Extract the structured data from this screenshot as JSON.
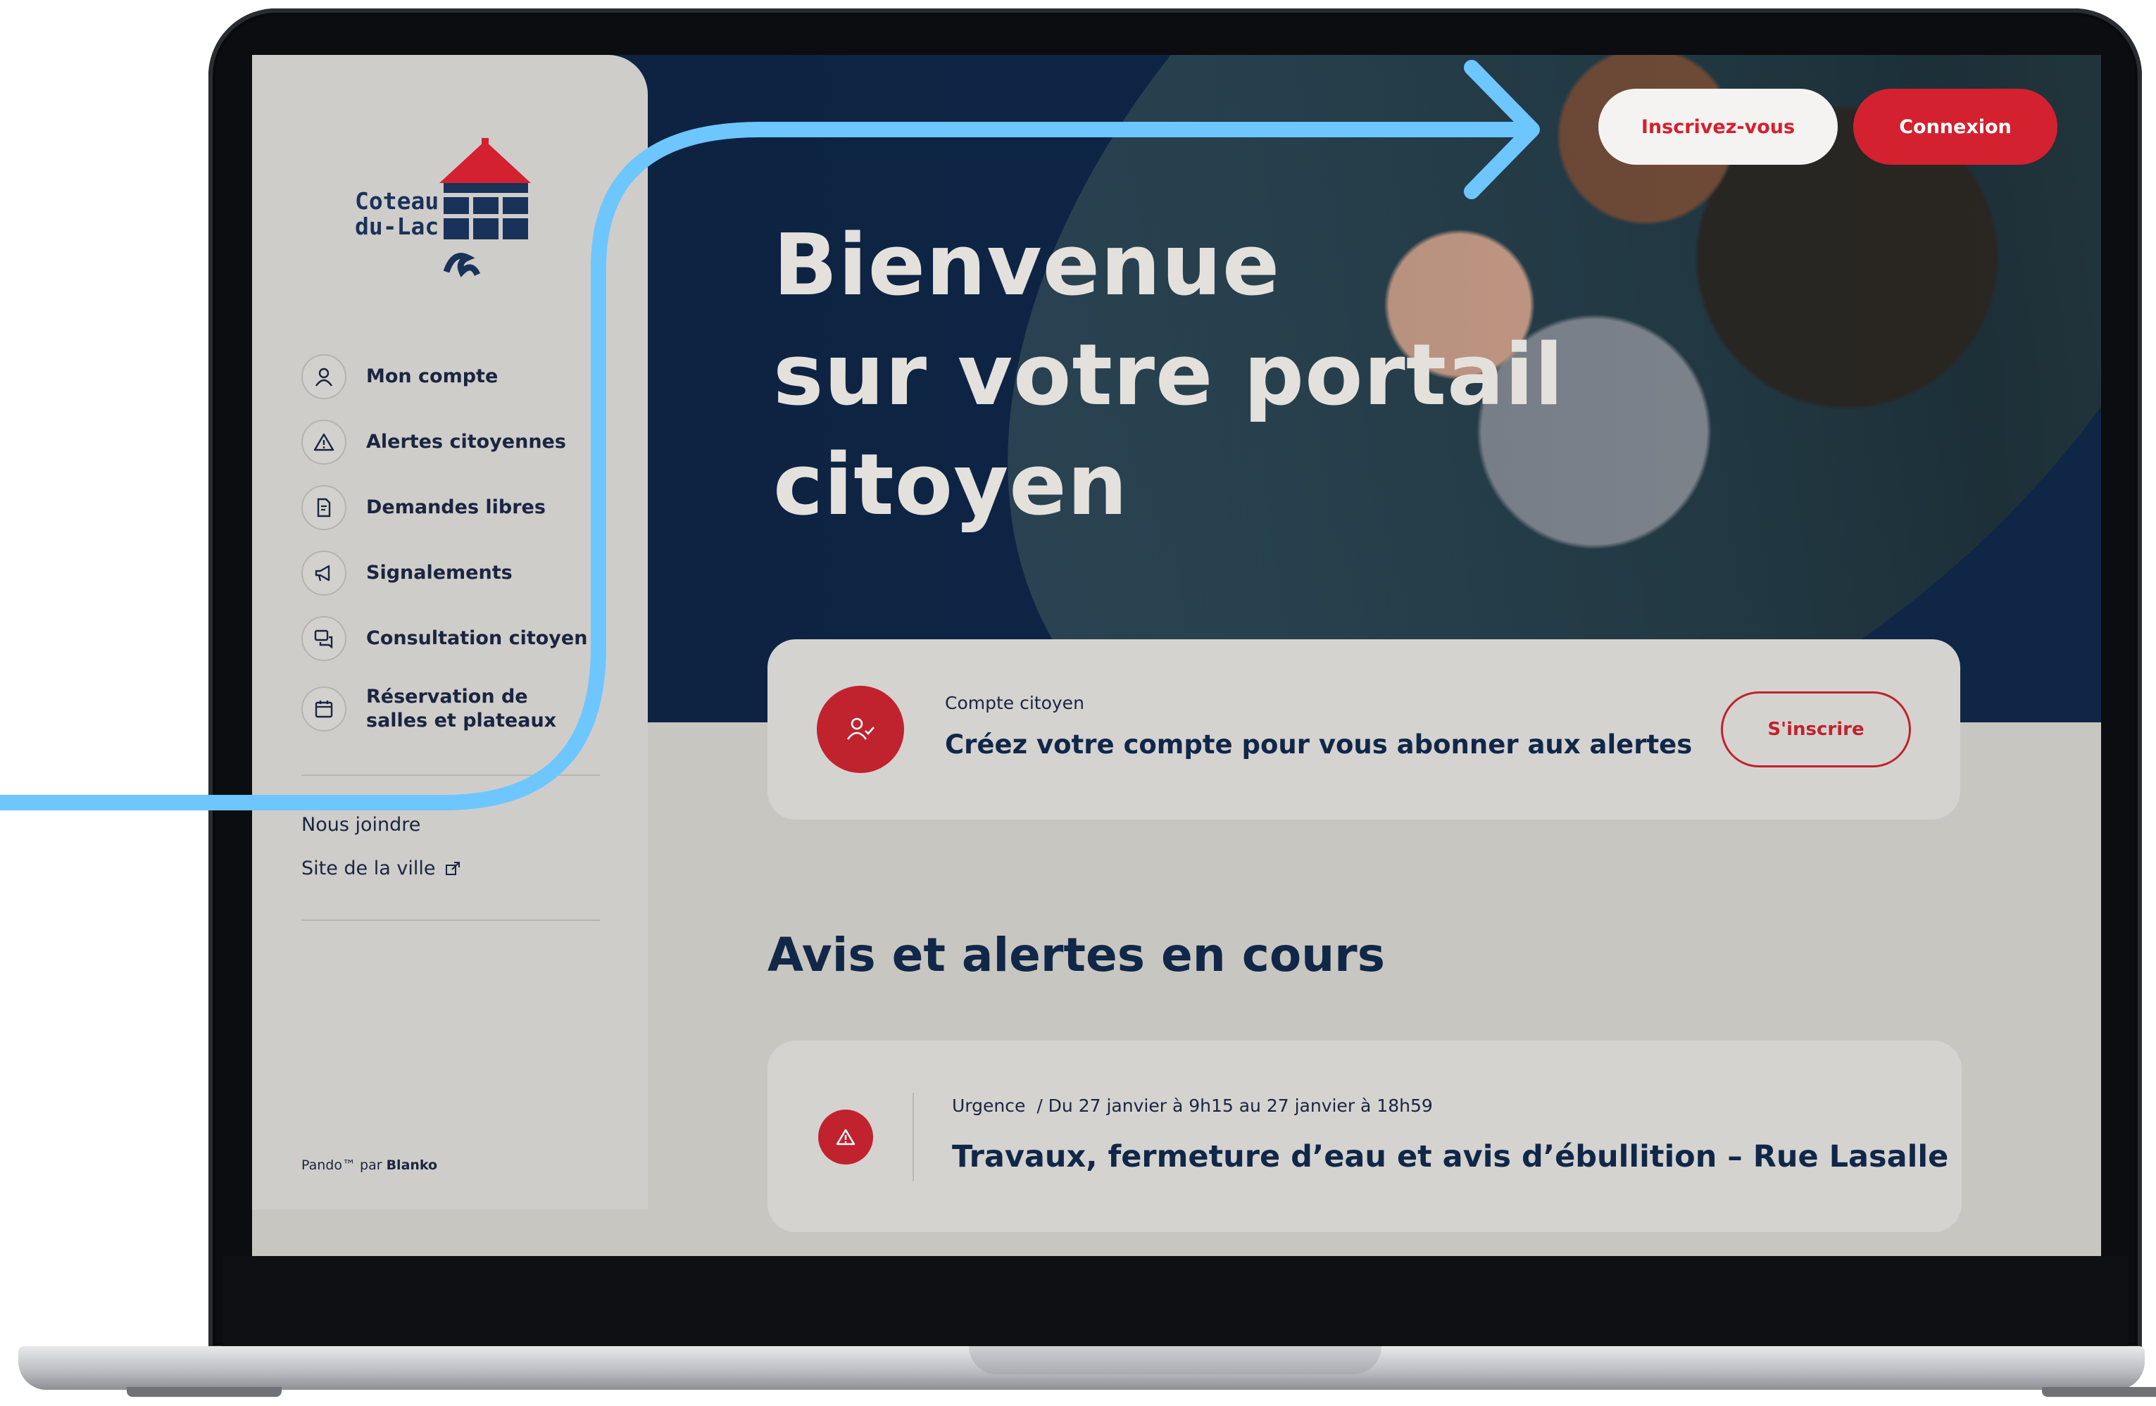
{
  "header": {
    "signup_label": "Inscrivez-vous",
    "login_label": "Connexion"
  },
  "hero": {
    "title_lines": [
      "Bienvenue",
      "sur votre portail",
      "citoyen"
    ]
  },
  "logo": {
    "lines": [
      "Coteau",
      "du-Lac"
    ]
  },
  "sidebar": {
    "items": [
      {
        "label": "Mon compte",
        "icon": "user-icon"
      },
      {
        "label": "Alertes citoyennes",
        "icon": "warning-icon"
      },
      {
        "label": "Demandes libres",
        "icon": "document-icon"
      },
      {
        "label": "Signalements",
        "icon": "megaphone-icon"
      },
      {
        "label": "Consultation citoyenne",
        "icon": "chat-icon"
      },
      {
        "label": "Réservation de salles et plateaux",
        "icon": "calendar-icon"
      }
    ],
    "contact_label": "Nous joindre",
    "city_site_label": "Site de la ville",
    "powered_prefix": "Pando™ par",
    "powered_brand": "Blanko"
  },
  "account_card": {
    "kicker": "Compte citoyen",
    "title": "Créez votre compte pour vous abonner aux alertes",
    "button_label": "S'inscrire"
  },
  "alerts": {
    "section_title": "Avis et alertes en cours",
    "items": [
      {
        "category": "Urgence",
        "period": "/ Du 27 janvier à 9h15 au 27 janvier à 18h59",
        "title": "Travaux, fermeture d’eau et avis d’ébullition  – Rue Lasalle"
      }
    ]
  },
  "colors": {
    "brand_navy": "#0f2647",
    "brand_red": "#d3212f",
    "annotation_blue": "#6ec6ff"
  }
}
